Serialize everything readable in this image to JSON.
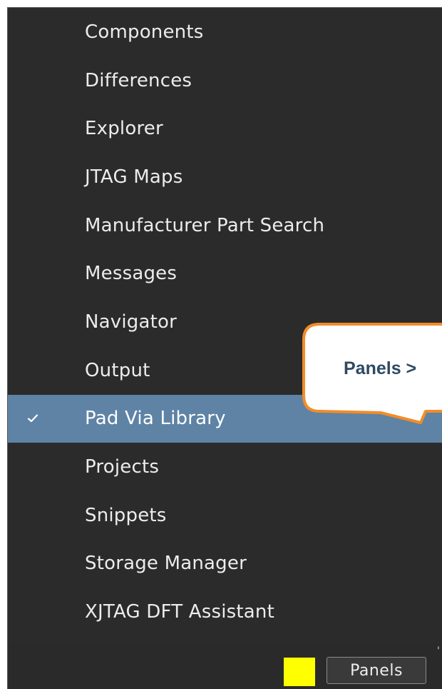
{
  "menu": {
    "items": [
      {
        "label": "Components",
        "checked": false
      },
      {
        "label": "Differences",
        "checked": false
      },
      {
        "label": "Explorer",
        "checked": false
      },
      {
        "label": "JTAG Maps",
        "checked": false
      },
      {
        "label": "Manufacturer Part Search",
        "checked": false
      },
      {
        "label": "Messages",
        "checked": false
      },
      {
        "label": "Navigator",
        "checked": false
      },
      {
        "label": "Output",
        "checked": false
      },
      {
        "label": "Pad Via Library",
        "checked": true
      },
      {
        "label": "Projects",
        "checked": false
      },
      {
        "label": "Snippets",
        "checked": false
      },
      {
        "label": "Storage Manager",
        "checked": false
      },
      {
        "label": "XJTAG DFT Assistant",
        "checked": false
      }
    ],
    "selected_index": 8,
    "check_glyph": "check-icon",
    "colors": {
      "background": "#2b2b2b",
      "selected": "#5e83a5",
      "text": "#ececec"
    }
  },
  "statusbar": {
    "color_swatch": "#ffff00",
    "panels_button_label": "Panels"
  },
  "callout": {
    "text": "Panels >",
    "border_color": "#f28c28",
    "text_color": "#2e4a62"
  }
}
